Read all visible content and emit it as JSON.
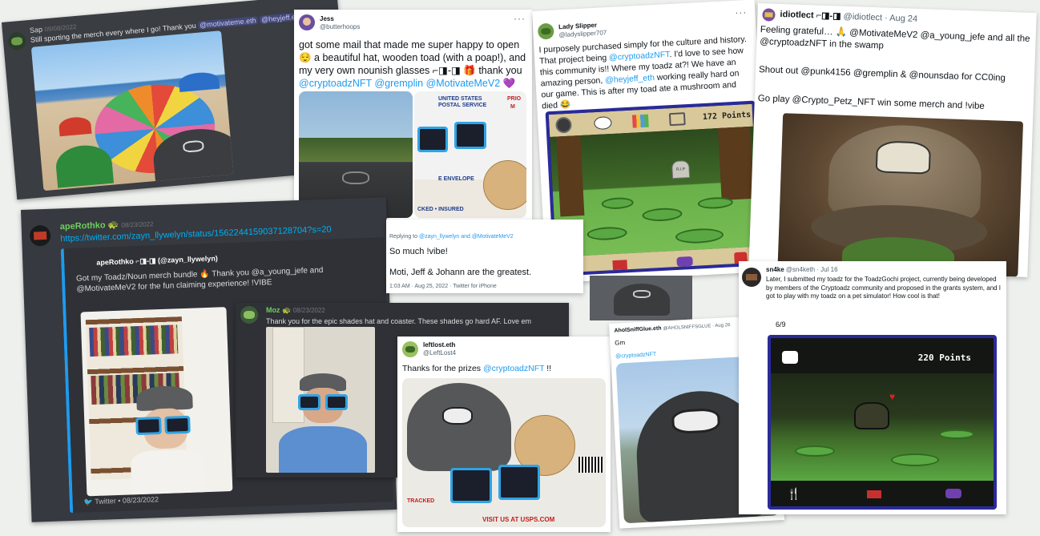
{
  "cards": {
    "sap": {
      "username": "Sap",
      "date": "09/08/2022",
      "text_before": "Still sporting the merch every where I go! Thank you ",
      "mention_1": "@motivateme.eth",
      "mention_2": "@heyjeff.eth"
    },
    "jess": {
      "name": "Jess",
      "handle": "@butterhoops",
      "text_1": "got some mail that made me super happy to open 😌 a beautiful hat, wooden toad (with a poap!), and my very own nounish glasses ⌐◨-◨ 🎁 thank you ",
      "mention_1": "@cryptoadzNFT",
      "mention_2": "@gremplin",
      "mention_3": "@MotivateMeV2",
      "emoji_end": "💜",
      "envelope_text_1": "UNITED STATES",
      "envelope_text_2": "POSTAL SERVICE",
      "envelope_text_3": "PRIO",
      "envelope_text_4": "M",
      "envelope_text_5": "E ENVELOPE",
      "envelope_text_6": "CKED • INSURED"
    },
    "lady": {
      "name": "Lady Slipper",
      "handle": "@ladyslipper707",
      "text_1": "I purposely purchased simply for the culture and history. That project being ",
      "mention_1": "@cryptoadzNFT",
      "text_2": ". I'd love to see how this community is!! Where my toadz at?! We have an amazing person, ",
      "mention_2": "@heyjeff_eth",
      "text_3": " working really hard on our game. This is after my toad ate a mushroom and died 😂",
      "points": "172 Points",
      "grave_text": "R.I.P"
    },
    "idiotlect": {
      "name": "idiotlect ⌐◨-◨",
      "handle": "@idiotlect · Aug 24",
      "line_1": "Feeling grateful… 🙏 @MotivateMeV2 @a_young_jefe and all the @cryptoadzNFT in the swamp",
      "line_2": "Shout out @punk4156 @gremplin & @nounsdao for CC0ing",
      "line_3": "Go play @Crypto_Petz_NFT win some merch and !vibe"
    },
    "aperothko": {
      "username": "apeRothko",
      "badge": "🐢",
      "date": "08/23/2022",
      "link": "https://twitter.com/zayn_llywelyn/status/1562244159037128704?s=20",
      "embed_author": "apeRothko ⌐◨-◨ (@zayn_llywelyn)",
      "embed_text": "Got my Toadz/Noun merch bundle 🔥 Thank you @a_young_jefe and @MotivateMeV2 for the fun claiming experience! !VIBE",
      "footer": "Twitter • 08/23/2022"
    },
    "reply": {
      "replying_prefix": "Replying to ",
      "replying_handles": "@zayn_llywelyn and @MotivateMeV2",
      "line_1": "So much !vibe!",
      "line_2": "Moti, Jeff & Johann are the greatest.",
      "meta": "1:03 AM · Aug 25, 2022 · Twitter for iPhone"
    },
    "moz": {
      "username": "Moz",
      "badge": "🐢",
      "date": "08/23/2022",
      "text": "Thank you for the epic shades hat and coaster. These shades go hard AF. Love em"
    },
    "leftlost": {
      "name": "leftlost.eth",
      "handle": "@LeftLost4",
      "text_before": "Thanks for the prizes ",
      "mention": "@cryptoadzNFT",
      "text_after": " !!",
      "box_text": "VISIT US AT USPS.COM",
      "label_text": "TRACKED"
    },
    "ahole": {
      "name": "AholSniffGlue.eth",
      "handle": "@AHOLSNIFFSGLUE · Aug 26",
      "text": "Gm",
      "mention": "@cryptoadzNFT"
    },
    "sn4ke": {
      "name": "sn4ke",
      "handle": "@sn4keth · Jul 16",
      "text": "Later, I submitted my toadz for the ToadzGochi project, currently being developed by members of the Cryptoadz community and proposed in the grants system, and I got to play with my toadz on a pet simulator! How cool is that!",
      "page": "6/9",
      "points": "220 Points"
    }
  },
  "colors": {
    "discord_bg": "#36393f",
    "twitter_blue": "#1d9bf0",
    "discord_link": "#00aff4",
    "game_frame": "#2a2a9a"
  },
  "icons": {
    "more": "more-dots-icon",
    "twitter": "twitter-bird-icon",
    "fire": "fire-emoji",
    "chat": "chat-bubble-icon"
  }
}
